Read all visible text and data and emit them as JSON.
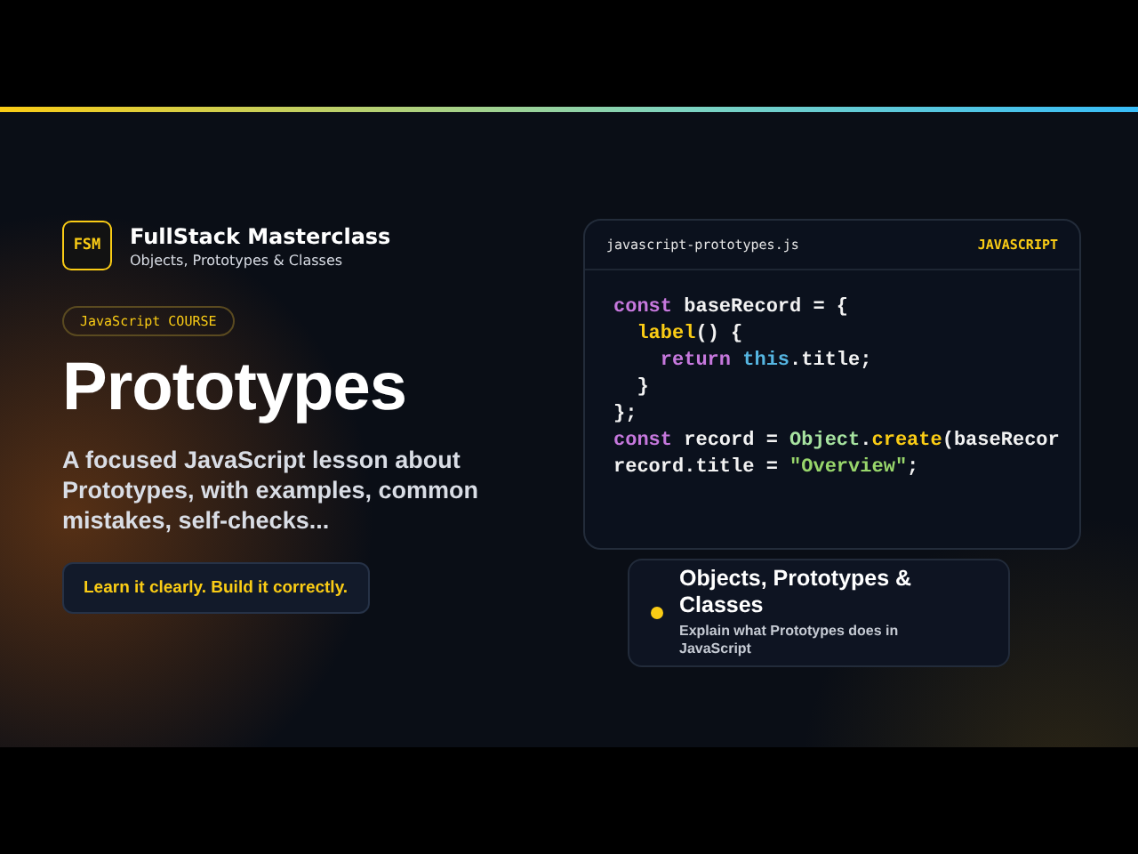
{
  "brand": {
    "logo": "FSM",
    "name": "FullStack Masterclass",
    "subtitle": "Objects, Prototypes & Classes"
  },
  "tag": "JavaScript COURSE",
  "title": "Prototypes",
  "description": "A focused JavaScript lesson about Prototypes, with examples, common mistakes, self-checks...",
  "tagline": "Learn it clearly. Build it correctly.",
  "code_card": {
    "filename": "javascript-prototypes.js",
    "language": "JAVASCRIPT",
    "lines": [
      [
        {
          "text": "const",
          "kind": "keyword"
        },
        {
          "text": " baseRecord = {",
          "kind": "plain"
        }
      ],
      [
        {
          "text": "  label",
          "kind": "function"
        },
        {
          "text": "() {",
          "kind": "plain"
        }
      ],
      [
        {
          "text": "    return ",
          "kind": "keyword"
        },
        {
          "text": "this",
          "kind": "builtin"
        },
        {
          "text": ".title;",
          "kind": "plain"
        }
      ],
      [
        {
          "text": "  }",
          "kind": "plain"
        }
      ],
      [
        {
          "text": "};",
          "kind": "plain"
        }
      ],
      [
        {
          "text": "const",
          "kind": "keyword"
        },
        {
          "text": " record = ",
          "kind": "plain"
        },
        {
          "text": "Object",
          "kind": "class"
        },
        {
          "text": ".",
          "kind": "plain"
        },
        {
          "text": "create",
          "kind": "function"
        },
        {
          "text": "(baseRecor",
          "kind": "plain"
        }
      ],
      [
        {
          "text": "record.title = ",
          "kind": "plain"
        },
        {
          "text": "\"Overview\"",
          "kind": "string"
        },
        {
          "text": ";",
          "kind": "plain"
        }
      ]
    ]
  },
  "topic_card": {
    "title": "Objects, Prototypes & Classes",
    "subtitle": "Explain what Prototypes does in JavaScript",
    "color": "#facc15"
  }
}
